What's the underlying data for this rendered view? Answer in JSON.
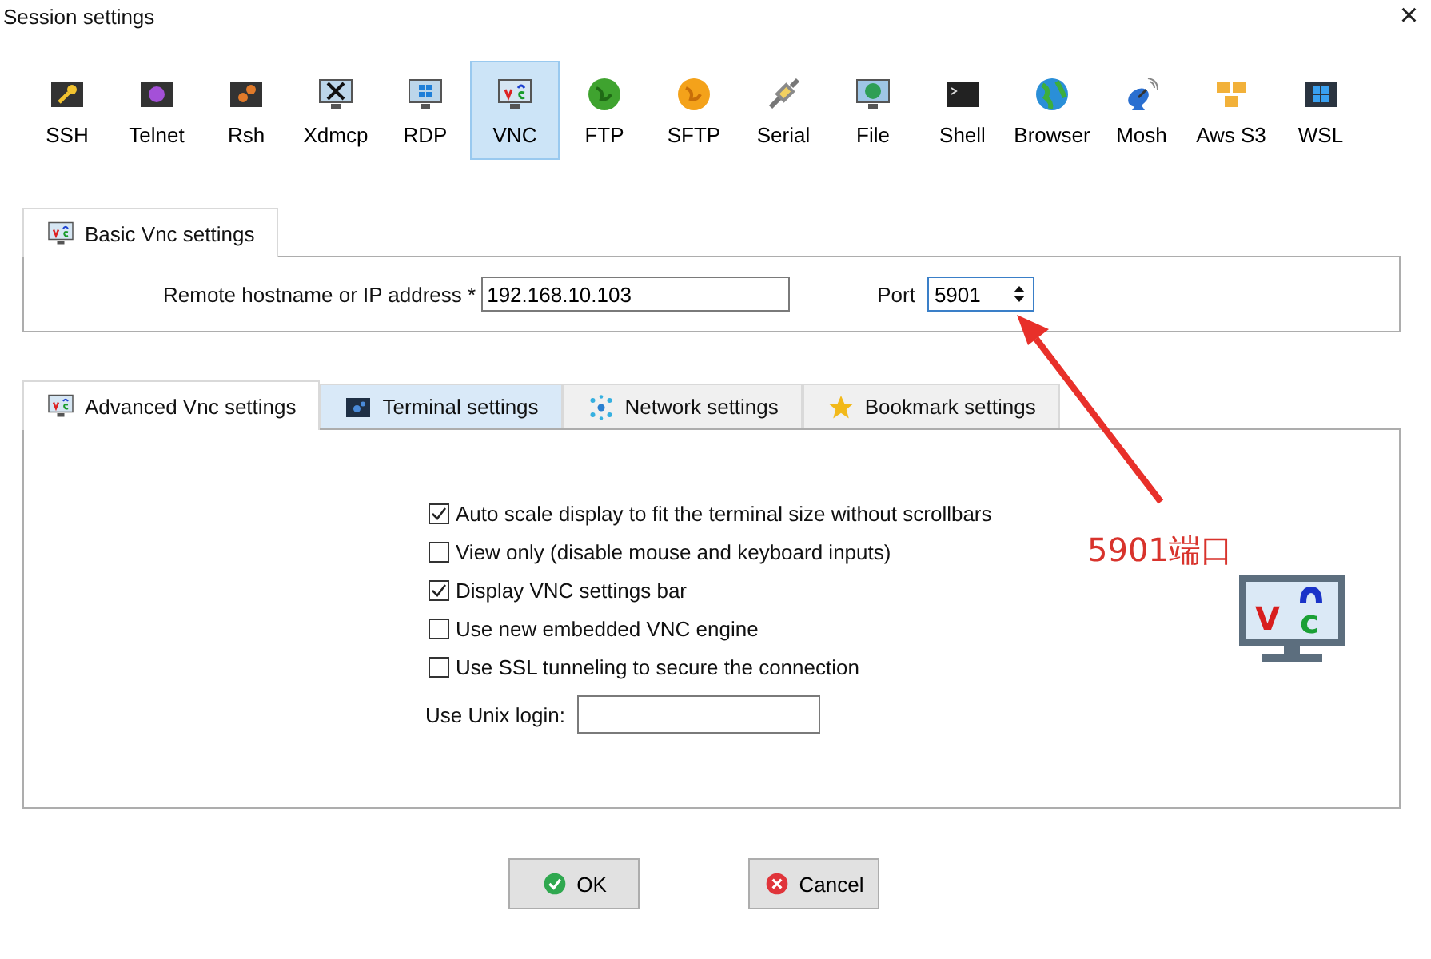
{
  "window": {
    "title": "Session settings",
    "close": "×"
  },
  "session_types": [
    {
      "label": "SSH",
      "kind": "ssh",
      "selected": false
    },
    {
      "label": "Telnet",
      "kind": "telnet",
      "selected": false
    },
    {
      "label": "Rsh",
      "kind": "rsh",
      "selected": false
    },
    {
      "label": "Xdmcp",
      "kind": "xdmcp",
      "selected": false
    },
    {
      "label": "RDP",
      "kind": "rdp",
      "selected": false
    },
    {
      "label": "VNC",
      "kind": "vnc",
      "selected": true
    },
    {
      "label": "FTP",
      "kind": "ftp",
      "selected": false
    },
    {
      "label": "SFTP",
      "kind": "sftp",
      "selected": false
    },
    {
      "label": "Serial",
      "kind": "serial",
      "selected": false
    },
    {
      "label": "File",
      "kind": "file",
      "selected": false
    },
    {
      "label": "Shell",
      "kind": "shell",
      "selected": false
    },
    {
      "label": "Browser",
      "kind": "browser",
      "selected": false
    },
    {
      "label": "Mosh",
      "kind": "mosh",
      "selected": false
    },
    {
      "label": "Aws S3",
      "kind": "s3",
      "selected": false
    },
    {
      "label": "WSL",
      "kind": "wsl",
      "selected": false
    }
  ],
  "basic": {
    "tab": "Basic Vnc settings",
    "host_label": "Remote hostname or IP address *",
    "host_value": "192.168.10.103",
    "port_label": "Port",
    "port_value": "5901"
  },
  "advanced_tabs": [
    {
      "label": "Advanced Vnc settings",
      "kind": "vnc",
      "selected": true,
      "highlighted": false
    },
    {
      "label": "Terminal settings",
      "kind": "terminal",
      "selected": false,
      "highlighted": true
    },
    {
      "label": "Network settings",
      "kind": "network",
      "selected": false,
      "highlighted": false
    },
    {
      "label": "Bookmark settings",
      "kind": "star",
      "selected": false,
      "highlighted": false
    }
  ],
  "options": [
    {
      "label": "Auto scale display to fit the terminal size without scrollbars",
      "checked": true
    },
    {
      "label": "View only (disable mouse and keyboard inputs)",
      "checked": false
    },
    {
      "label": "Display VNC settings bar",
      "checked": true
    },
    {
      "label": "Use new embedded VNC engine",
      "checked": false
    },
    {
      "label": "Use SSL tunneling to secure the connection",
      "checked": false
    }
  ],
  "unix_login": {
    "label": "Use Unix login:"
  },
  "vnc_logo": {
    "letters": [
      "V",
      "c"
    ]
  },
  "annotation": {
    "text": "5901端口"
  },
  "buttons": [
    {
      "label": "OK",
      "kind": "ok"
    },
    {
      "label": "Cancel",
      "kind": "cancel"
    }
  ]
}
